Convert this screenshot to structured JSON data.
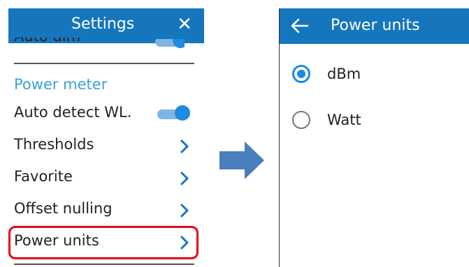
{
  "settings_panel": {
    "title": "Settings",
    "close_icon": "close-icon",
    "partial_row_label": "Auto dim",
    "section_title": "Power meter",
    "rows": [
      {
        "label": "Auto detect WL.",
        "control": "toggle",
        "state": "on"
      },
      {
        "label": "Thresholds",
        "control": "chevron-right-icon"
      },
      {
        "label": "Favorite",
        "control": "chevron-right-icon"
      },
      {
        "label": "Offset nulling",
        "control": "chevron-right-icon"
      },
      {
        "label": "Power units",
        "control": "chevron-right-icon",
        "highlighted": true
      }
    ]
  },
  "arrow_icon": "arrow-right-icon",
  "power_units_panel": {
    "title": "Power units",
    "back_icon": "arrow-left-icon",
    "options": [
      {
        "label": "dBm",
        "selected": true
      },
      {
        "label": "Watt",
        "selected": false
      }
    ]
  },
  "colors": {
    "header": "#1576be",
    "accent": "#1e8ae0",
    "section_title": "#3d9fdc",
    "highlight": "#e8001a",
    "arrow": "#4a7ebd"
  }
}
